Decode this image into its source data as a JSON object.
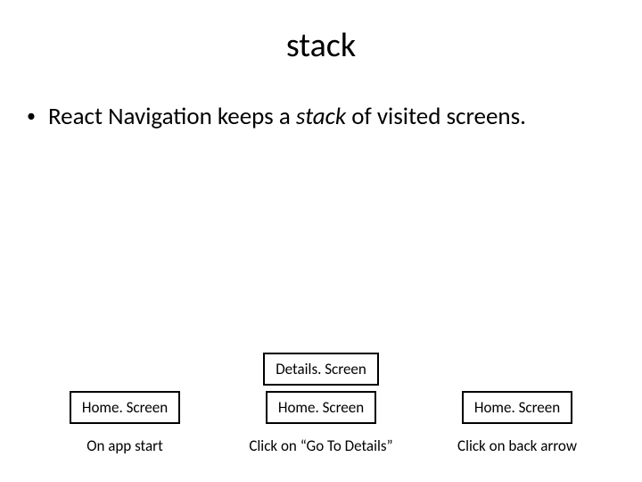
{
  "title": "stack",
  "bullet": {
    "prefix": "React Navigation keeps a ",
    "emph": "stack",
    "suffix": " of visited screens."
  },
  "columns": [
    {
      "blocks": [
        "Home. Screen"
      ],
      "caption": "On app start"
    },
    {
      "blocks": [
        "Details. Screen",
        "Home. Screen"
      ],
      "caption": "Click on “Go To Details”"
    },
    {
      "blocks": [
        "Home. Screen"
      ],
      "caption": "Click on back arrow"
    }
  ]
}
